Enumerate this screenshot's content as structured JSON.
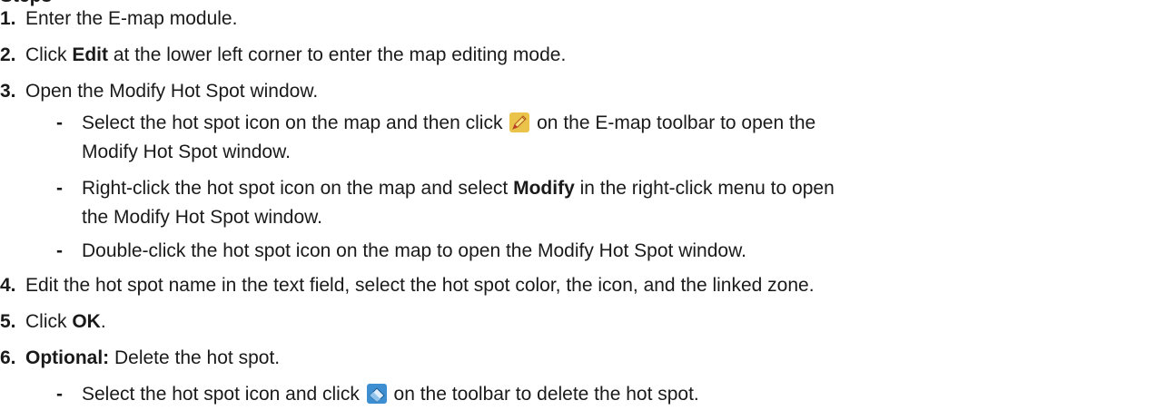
{
  "clipped_heading": "Steps",
  "steps": [
    {
      "num": "1.",
      "text": "Enter the E-map module."
    },
    {
      "num": "2.",
      "pre": "Click ",
      "bold": "Edit",
      "post": " at the lower left corner to enter the map editing mode."
    },
    {
      "num": "3.",
      "text": "Open the Modify Hot Spot window."
    },
    {
      "num": "4.",
      "text": "Edit the hot spot name in the text field, select the hot spot color, the icon, and the linked zone."
    },
    {
      "num": "5.",
      "pre": "Click ",
      "bold": "OK",
      "post": "."
    },
    {
      "num": "6.",
      "bold": "Optional:",
      "post": " Delete the hot spot."
    }
  ],
  "substeps_3": [
    {
      "bullet": "-",
      "pre": "Select the hot spot icon on the map and then click ",
      "icon": "edit-pencil-icon",
      "post": " on the E-map toolbar to open the",
      "cont": "Modify Hot Spot window."
    },
    {
      "bullet": "-",
      "pre": "Right-click the hot spot icon on the map and select ",
      "bold": "Modify",
      "post": " in the right-click menu to open",
      "cont": "the Modify Hot Spot window."
    },
    {
      "bullet": "-",
      "text": "Double-click the hot spot icon on the map to open the Modify Hot Spot window."
    }
  ],
  "substeps_6": [
    {
      "bullet": "-",
      "pre": "Select the hot spot icon and click ",
      "icon": "eraser-delete-icon",
      "post": " on the toolbar to delete the hot spot."
    }
  ]
}
